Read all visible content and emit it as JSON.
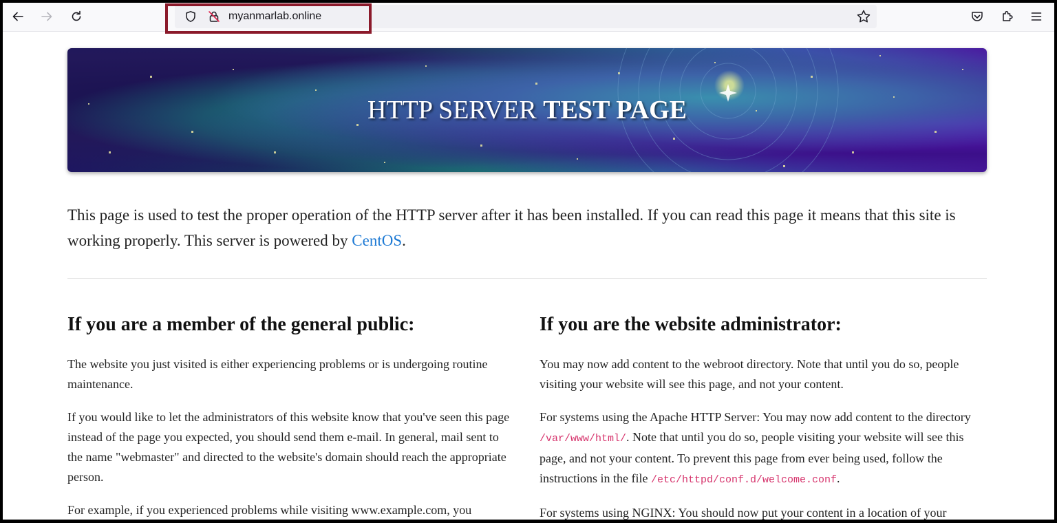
{
  "browser": {
    "url": "myanmarlab.online",
    "icons": {
      "back": "arrow-left-icon",
      "forward": "arrow-right-icon",
      "reload": "reload-icon",
      "shield": "shield-icon",
      "insecure_lock": "insecure-lock-icon",
      "bookmark": "star-icon",
      "pocket": "pocket-icon",
      "extensions": "puzzle-icon",
      "menu": "hamburger-menu-icon"
    },
    "highlight_color": "#8b1a2b"
  },
  "hero": {
    "title_normal": "HTTP SERVER ",
    "title_bold": "TEST PAGE"
  },
  "intro": {
    "text_before_link": "This page is used to test the proper operation of the HTTP server after it has been installed. If you can read this page it means that this site is working properly. This server is powered by ",
    "link_text": "CentOS",
    "text_after_link": ".",
    "link_color": "#1e7ad4"
  },
  "public_section": {
    "heading": "If you are a member of the general public:",
    "p1": "The website you just visited is either experiencing problems or is undergoing routine maintenance.",
    "p2": "If you would like to let the administrators of this website know that you've seen this page instead of the page you expected, you should send them e-mail. In general, mail sent to the name \"webmaster\" and directed to the website's domain should reach the appropriate person.",
    "p3": "For example, if you experienced problems while visiting www.example.com, you"
  },
  "admin_section": {
    "heading": "If you are the website administrator:",
    "p1": "You may now add content to the webroot directory. Note that until you do so, people visiting your website will see this page, and not your content.",
    "p2_before": "For systems using the Apache HTTP Server: You may now add content to the directory ",
    "p2_code1": "/var/www/html/",
    "p2_middle": ". Note that until you do so, people visiting your website will see this page, and not your content. To prevent this page from ever being used, follow the instructions in the file ",
    "p2_code2": "/etc/httpd/conf.d/welcome.conf",
    "p2_after": ".",
    "p3": "For systems using NGINX: You should now put your content in a location of your"
  }
}
